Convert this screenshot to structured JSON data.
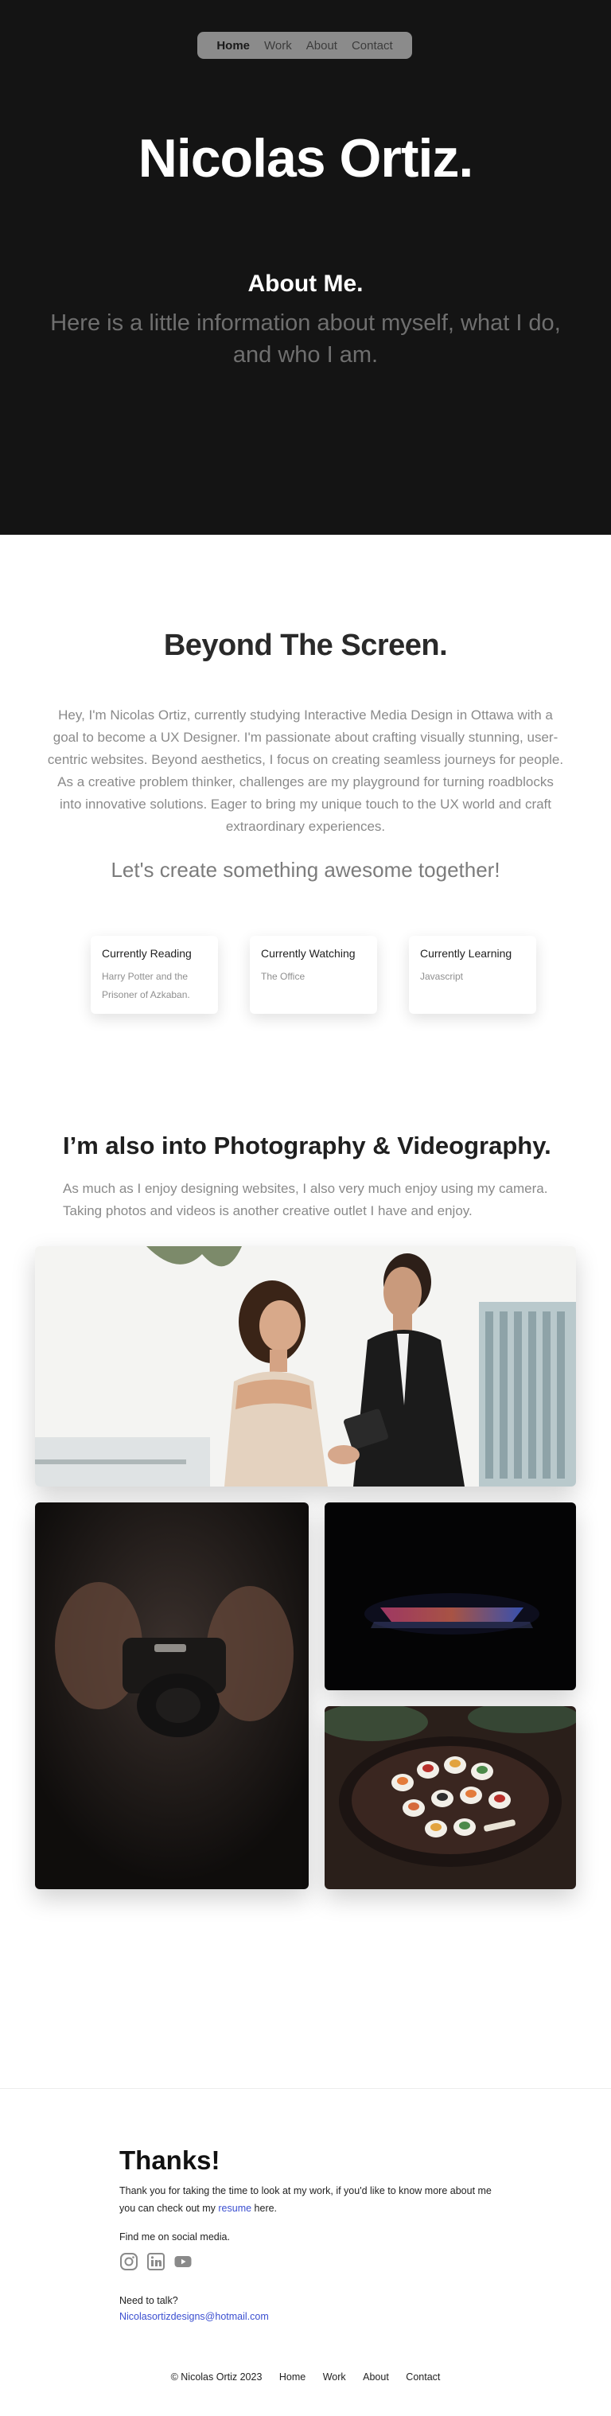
{
  "nav": {
    "items": [
      "Home",
      "Work",
      "About",
      "Contact"
    ],
    "active": "Home"
  },
  "hero": {
    "name": "Nicolas Ortiz.",
    "about_heading": "About Me.",
    "intro": "Here is a little information about myself, what I do, and who I am."
  },
  "beyond": {
    "title": "Beyond The Screen.",
    "body": "Hey, I'm Nicolas Ortiz, currently studying Interactive Media Design in Ottawa with a goal to become a UX Designer.  I'm passionate about crafting visually stunning, user-centric websites. Beyond aesthetics, I focus on creating seamless journeys for people. As a creative problem thinker, challenges are my playground for turning roadblocks into innovative solutions. Eager to bring my unique touch to the UX world and craft extraordinary experiences.",
    "cta": "Let's create something awesome together!"
  },
  "cards": [
    {
      "title": "Currently Reading",
      "text": "Harry Potter and the Prisoner of Azkaban."
    },
    {
      "title": "Currently Watching",
      "text": "The Office"
    },
    {
      "title": "Currently Learning",
      "text": "Javascript"
    }
  ],
  "photography": {
    "title": "I’m also into Photography & Videography.",
    "body": "As much as I enjoy designing websites, I also very much enjoy using my camera. Taking photos and videos is another creative outlet I have and enjoy."
  },
  "footer": {
    "thanks": "Thanks!",
    "thanks_text_before": "Thank you for taking the time to look at my work, if you'd like to know more about me you can check out my ",
    "resume_link": "resume",
    "thanks_text_after": " here.",
    "social_label": "Find me on social media.",
    "social_icons": [
      "instagram-icon",
      "linkedin-icon",
      "youtube-icon"
    ],
    "talk_label": "Need to talk?",
    "email": "Nicolasortizdesigns@hotmail.com",
    "copyright": "© Nicolas Ortiz 2023",
    "links": [
      "Home",
      "Work",
      "About",
      "Contact"
    ]
  },
  "colors": {
    "hero_bg": "#141414",
    "nav_pill": "#8b8b8b",
    "link": "#3b4fd0",
    "muted_text": "#8a8a8a"
  }
}
